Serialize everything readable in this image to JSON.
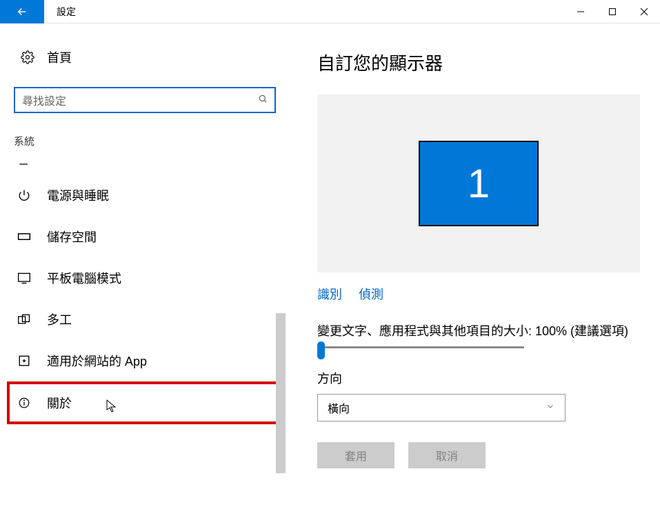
{
  "app": {
    "title": "設定"
  },
  "sidebar": {
    "home": "首頁",
    "searchPlaceholder": "尋找設定",
    "section": "系統",
    "items": [
      {
        "label": ""
      },
      {
        "label": "電源與睡眠"
      },
      {
        "label": "儲存空間"
      },
      {
        "label": "平板電腦模式"
      },
      {
        "label": "多工"
      },
      {
        "label": "適用於網站的 App"
      },
      {
        "label": "關於"
      }
    ]
  },
  "main": {
    "title": "自訂您的顯示器",
    "monitorNumber": "1",
    "identify": "識別",
    "detect": "偵測",
    "scaleLabel": "變更文字、應用程式與其他項目的大小: 100% (建議選項)",
    "orientationLabel": "方向",
    "orientationValue": "橫向",
    "apply": "套用",
    "cancel": "取消"
  }
}
